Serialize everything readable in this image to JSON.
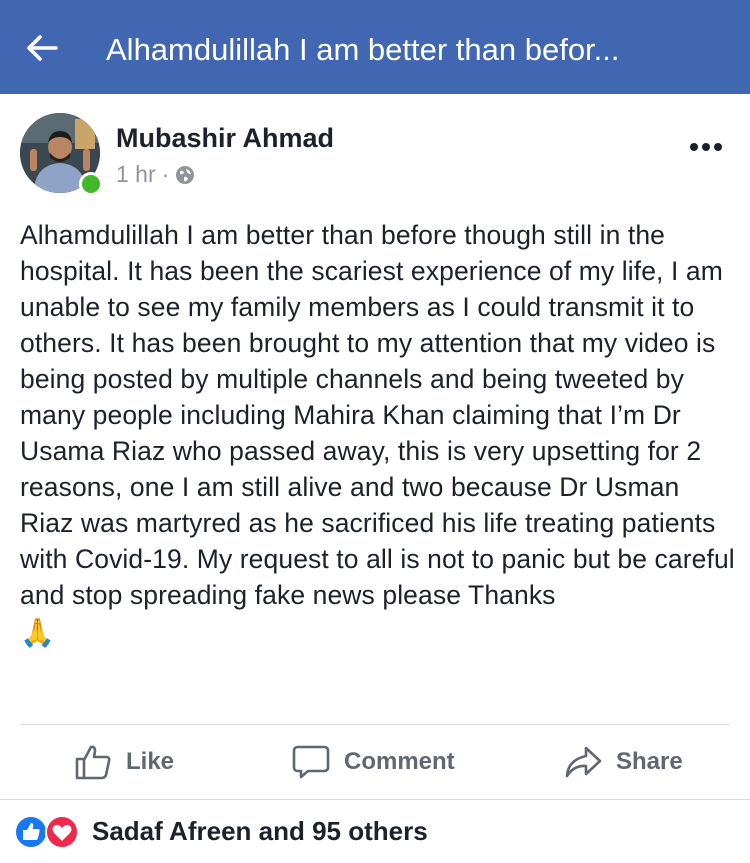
{
  "header": {
    "title": "Alhamdulillah I am better than befor..."
  },
  "post": {
    "author": "Mubashir Ahmad",
    "time": "1 hr",
    "separator": "·",
    "privacy_icon": "globe-icon",
    "text": "Alhamdulillah I am better than before though still in the hospital. It has been the scariest experience of my life, I am unable to see my family members as I could transmit it to others. It has been brought to my attention that my video is being posted by multiple channels and being tweeted by many people including Mahira Khan claiming that I’m Dr Usama Riaz who passed away, this is very upsetting for 2 reasons, one I am still alive and two because Dr Usman Riaz was martyred as he sacrificed his life treating patients with Covid-19. My request to all is not to panic but be careful and stop spreading fake news please Thanks",
    "emoji": "🙏"
  },
  "actions": {
    "like_label": "Like",
    "comment_label": "Comment",
    "share_label": "Share"
  },
  "reactions": {
    "summary": "Sadaf Afreen and 95 others",
    "icons": [
      "like-icon",
      "love-icon"
    ]
  },
  "colors": {
    "brand": "#4267b2",
    "online": "#42b72a",
    "like_blue": "#1877f2",
    "love_red": "#f0284a",
    "muted": "#606770"
  }
}
